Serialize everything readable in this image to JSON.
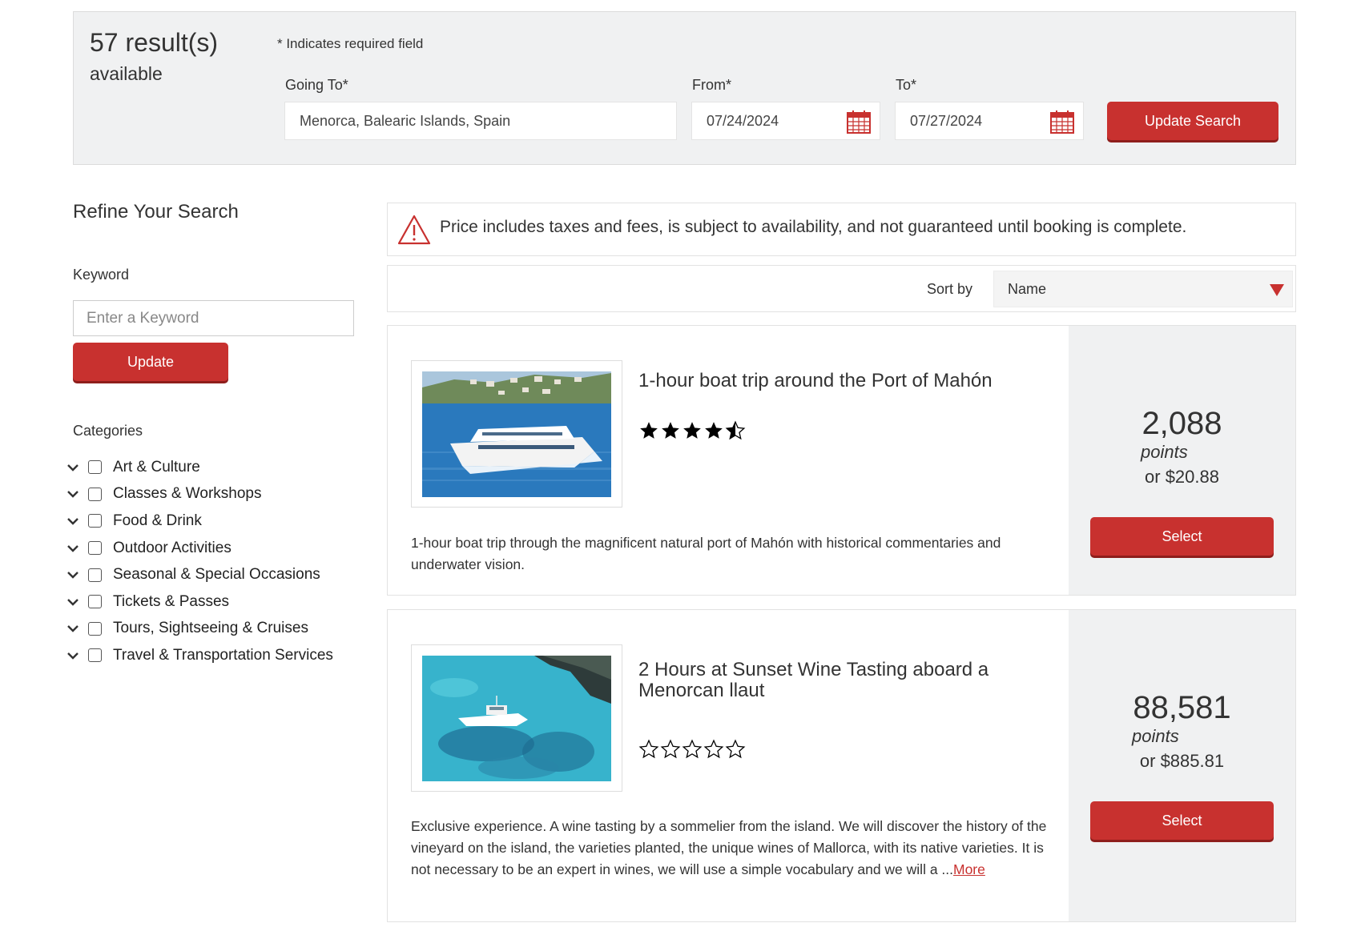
{
  "search": {
    "results_count": "57 result(s)",
    "results_available": "available",
    "required_note": "* Indicates required field",
    "going_to_label": "Going To*",
    "going_to_value": "Menorca, Balearic Islands, Spain",
    "from_label": "From*",
    "from_value": "07/24/2024",
    "to_label": "To*",
    "to_value": "07/27/2024",
    "update_search_label": "Update Search"
  },
  "sidebar": {
    "title": "Refine Your Search",
    "keyword_label": "Keyword",
    "keyword_placeholder": "Enter a Keyword",
    "update_label": "Update",
    "categories_label": "Categories",
    "categories": [
      "Art & Culture",
      "Classes & Workshops",
      "Food & Drink",
      "Outdoor Activities",
      "Seasonal & Special Occasions",
      "Tickets & Passes",
      "Tours, Sightseeing & Cruises",
      "Travel & Transportation Services"
    ]
  },
  "notice": {
    "icon": "warning-triangle-icon",
    "text": "Price includes taxes and fees, is subject to availability, and not guaranteed until booking is complete."
  },
  "sort": {
    "label": "Sort by",
    "selected": "Name"
  },
  "results": [
    {
      "title": "1-hour boat trip around the Port of Mahón",
      "rating": 4.5,
      "rating_max": 5,
      "description": "1-hour boat trip through the magnificent natural port of Mahón with historical commentaries and underwater vision.",
      "points": "2,088",
      "points_word": "points",
      "cash": "or $20.88",
      "select_label": "Select"
    },
    {
      "title": "2 Hours at Sunset Wine Tasting aboard a Menorcan llaut",
      "rating": 0,
      "rating_max": 5,
      "description": "Exclusive experience. A wine tasting by a sommelier from the island. We will discover the history of the vineyard on the island, the varieties planted, the unique wines of Mallorca, with its native varieties. It is not necessary to be an expert in wines, we will use a simple vocabulary and we will a ...",
      "more_label": "More",
      "points": "88,581",
      "points_word": "points",
      "cash": "or $885.81",
      "select_label": "Select"
    }
  ],
  "colors": {
    "accent": "#c8312f",
    "panel": "#f0f1f2"
  }
}
